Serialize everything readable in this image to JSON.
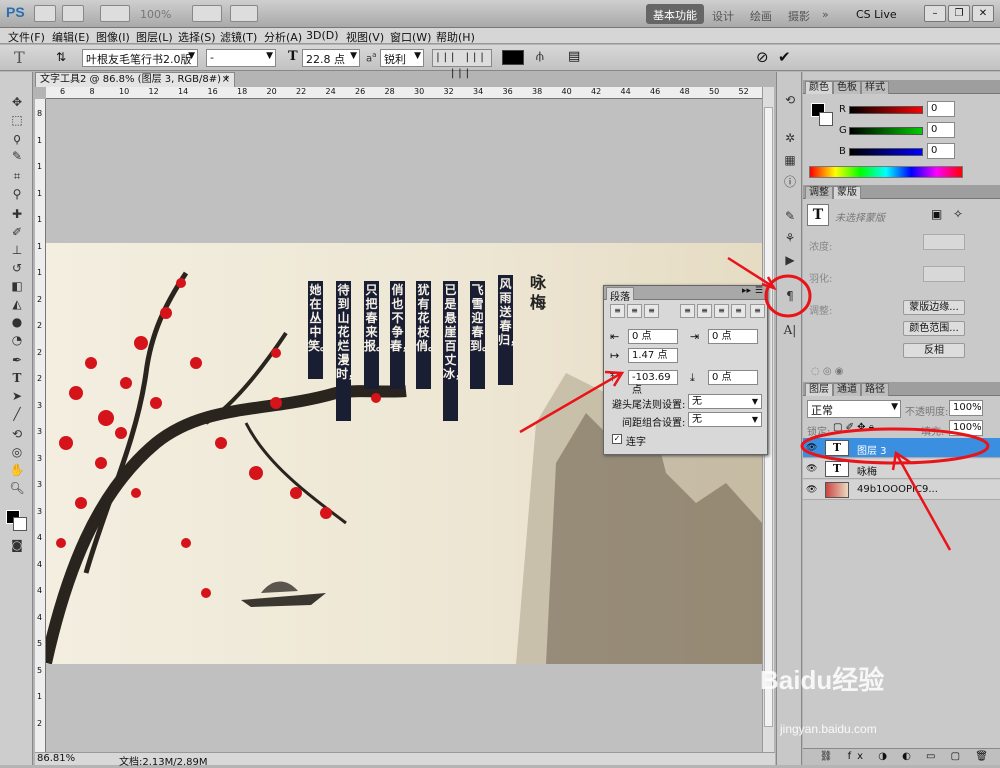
{
  "app": {
    "logo": "PS",
    "zoom": "100%",
    "workspace_active": "基本功能",
    "workspace_links": [
      "设计",
      "绘画",
      "摄影"
    ],
    "cs_live": "CS Live"
  },
  "menu": [
    "文件(F)",
    "编辑(E)",
    "图像(I)",
    "图层(L)",
    "选择(S)",
    "滤镜(T)",
    "分析(A)",
    "3D(D)",
    "视图(V)",
    "窗口(W)",
    "帮助(H)"
  ],
  "options": {
    "font_family": "叶根友毛笔行书2.0版",
    "font_style": "-",
    "font_size": "22.8 点",
    "aa_label": "a",
    "antialias": "锐利",
    "text_color": "#000000"
  },
  "document": {
    "tab_title": "文字工具2 @ 86.8% (图层 3, RGB/8#) *",
    "ruler_h": [
      "6",
      "8",
      "10",
      "12",
      "14",
      "16",
      "18",
      "20",
      "22",
      "24",
      "26",
      "28",
      "30",
      "32",
      "34",
      "36",
      "38",
      "40",
      "42",
      "44",
      "46",
      "48",
      "50",
      "52"
    ],
    "ruler_v": [
      "8",
      "1",
      "1",
      "1",
      "1",
      "1",
      "1",
      "2",
      "2",
      "2",
      "2",
      "3",
      "3",
      "3",
      "3",
      "3",
      "4",
      "4",
      "4",
      "4",
      "5",
      "5",
      "1",
      "2"
    ],
    "status_zoom": "86.81%",
    "status_doc": "文档:2.13M/2.89M"
  },
  "artwork": {
    "title": "咏梅",
    "columns": [
      "风雨送春归，",
      "飞雪迎春到。",
      "已是悬崖百丈冰，",
      "犹有花枝俏。",
      "俏也不争春，",
      "只把春来报。",
      "待到山花烂漫时，",
      "她在丛中笑。"
    ]
  },
  "paragraph_panel": {
    "tab": "段落",
    "indent_left": "0 点",
    "indent_right": "0 点",
    "indent_first": "1.47 点",
    "space_before": "-103.69 点",
    "space_after": "0 点",
    "kinsoku_label": "避头尾法则设置:",
    "kinsoku_value": "无",
    "mojikumi_label": "间距组合设置:",
    "mojikumi_value": "无",
    "hyphenate_label": "连字"
  },
  "color_panel": {
    "tabs": [
      "颜色",
      "色板",
      "样式"
    ],
    "r_label": "R",
    "g_label": "G",
    "b_label": "B",
    "r": "0",
    "g": "0",
    "b": "0"
  },
  "adjust_panel": {
    "tabs": [
      "调整",
      "蒙版"
    ],
    "no_selection": "未选择蒙版",
    "density_label": "浓度:",
    "feather_label": "羽化:",
    "refine_label": "调整:",
    "mask_edge": "蒙版边缘...",
    "color_range": "颜色范围...",
    "invert": "反相"
  },
  "layers_panel": {
    "tabs": [
      "图层",
      "通道",
      "路径"
    ],
    "blend_mode": "正常",
    "opacity_label": "不透明度:",
    "opacity": "100%",
    "lock_label": "锁定:",
    "fill_label": "填充:",
    "fill": "100%",
    "layers": [
      {
        "name": "图层 3",
        "type": "T",
        "selected": true
      },
      {
        "name": "咏梅",
        "type": "T",
        "selected": false
      },
      {
        "name": "49b1OOOPIC9...",
        "type": "img",
        "selected": false
      }
    ]
  },
  "watermark": {
    "brand": "Baidu经验",
    "url": "jingyan.baidu.com"
  }
}
